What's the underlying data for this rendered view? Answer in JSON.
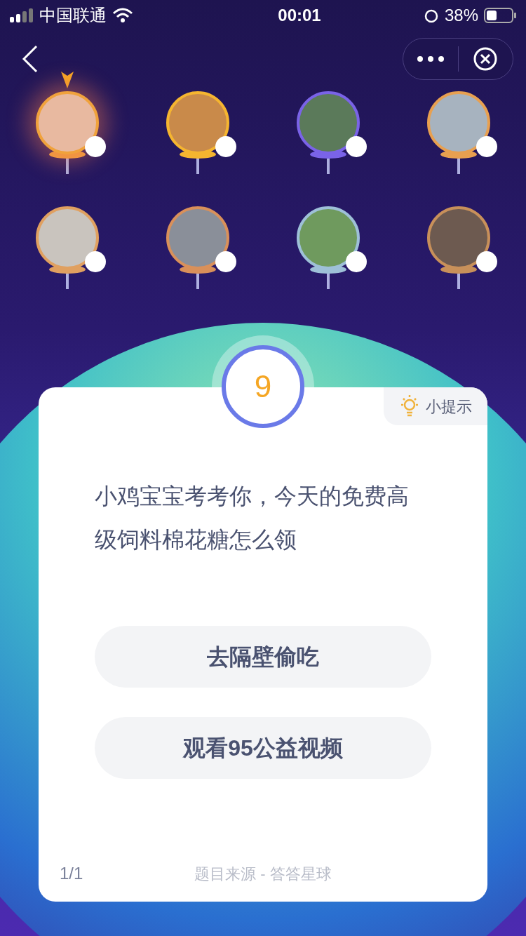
{
  "status_bar": {
    "carrier": "中国联通",
    "time": "00:01",
    "battery": "38%"
  },
  "players": [
    {
      "selected": true
    },
    {
      "selected": false
    },
    {
      "selected": false
    },
    {
      "selected": false
    },
    {
      "selected": false
    },
    {
      "selected": false
    },
    {
      "selected": false
    },
    {
      "selected": false
    }
  ],
  "question": {
    "number": "9",
    "hint": "小提示",
    "text": "小鸡宝宝考考你，今天的免费高级饲料棉花糖怎么领",
    "options": [
      "去隔壁偷吃",
      "观看95公益视频"
    ],
    "progress": "1/1",
    "source": "题目来源 - 答答星球"
  }
}
